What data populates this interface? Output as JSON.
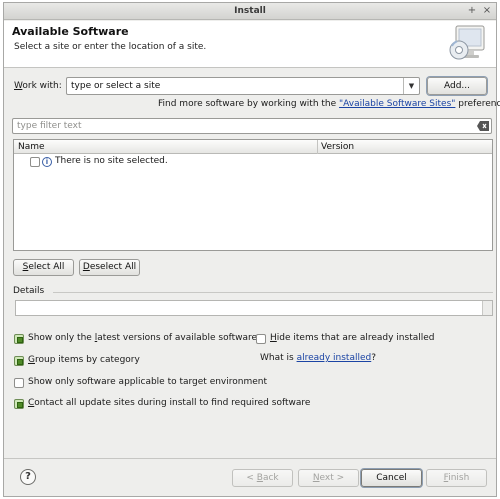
{
  "window": {
    "title": "Install"
  },
  "header": {
    "title": "Available Software",
    "description": "Select a site or enter the location of a site."
  },
  "work_with": {
    "label_mnemonic": "W",
    "label_rest": "ork with:",
    "value": "type or select a site",
    "add_button": "Add..."
  },
  "find_more": {
    "prefix": "Find more software by working with the ",
    "link": "\"Available Software Sites\"",
    "suffix": " preferences."
  },
  "filter": {
    "placeholder": "type filter text"
  },
  "table": {
    "columns": [
      "Name",
      "Version"
    ],
    "rows": [
      {
        "name": "There is no site selected."
      }
    ]
  },
  "buttons": {
    "select_all_mnemonic": "S",
    "select_all_rest": "elect All",
    "deselect_all_mnemonic": "D",
    "deselect_all_rest": "eselect All"
  },
  "details": {
    "label": "Details"
  },
  "options": {
    "latest_versions": {
      "pre": "Show only the ",
      "mn": "l",
      "post": "atest versions of available software",
      "checked": true
    },
    "group_by_category": {
      "pre": "",
      "mn": "G",
      "post": "roup items by category",
      "checked": true
    },
    "target_env": {
      "pre": "Show only software applicable to target environment",
      "mn": "",
      "post": "",
      "checked": false
    },
    "contact_sites": {
      "pre": "",
      "mn": "C",
      "post": "ontact all update sites during install to find required software",
      "checked": true
    },
    "hide_installed": {
      "pre": "",
      "mn": "H",
      "post": "ide items that are already installed",
      "checked": false
    }
  },
  "already_installed": {
    "prefix": "What is ",
    "link": "already installed",
    "suffix": "?"
  },
  "footer": {
    "back": "< Back",
    "back_mn": "B",
    "next": "Next >",
    "next_mn": "N",
    "cancel": "Cancel",
    "finish": "Finish",
    "finish_mn": "F"
  }
}
